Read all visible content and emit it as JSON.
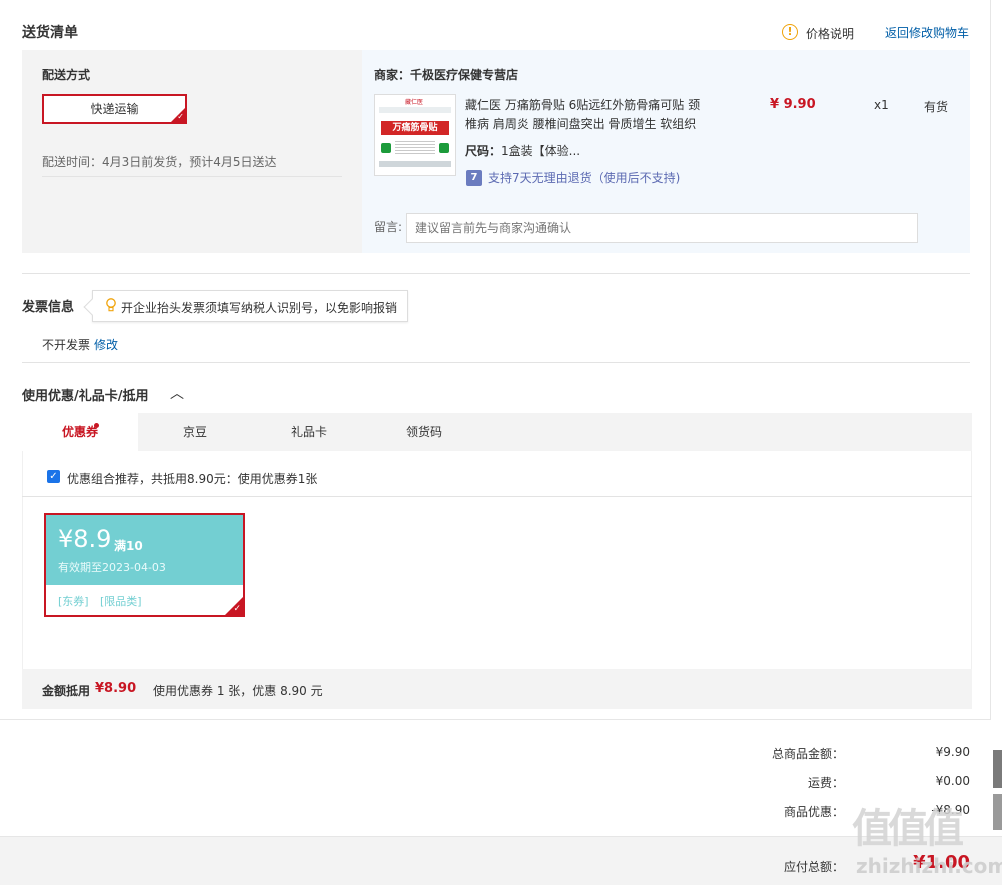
{
  "delivery": {
    "title": "送货清单",
    "price_note": "价格说明",
    "back_to_cart": "返回修改购物车",
    "method_label": "配送方式",
    "method_value": "快递运输",
    "delivery_time": "配送时间：4月3日前发货，预计4月5日送达"
  },
  "merchant": {
    "name": "商家：千极医疗保健专营店",
    "product": {
      "title_line1": "藏仁医 万痛筋骨贴 6贴远红外筋骨痛可贴 颈",
      "title_line2": "椎病 肩周炎 腰椎间盘突出 骨质增生 软组织",
      "image_text": "万痛筋骨贴",
      "image_brand": "藏仁医",
      "price": "¥ 9.90",
      "qty": "x1",
      "stock": "有货",
      "size_label": "尺码：",
      "size_value": "1盒装【体验...",
      "return_icon_text": "7",
      "return_policy": "支持7天无理由退货（使用后不支持)"
    },
    "message_label": "留言:",
    "message_placeholder": "建议留言前先与商家沟通确认"
  },
  "invoice": {
    "title": "发票信息",
    "tip": "开企业抬头发票须填写纳税人识别号，以免影响报销",
    "status": "不开发票",
    "edit": "修改"
  },
  "discount": {
    "title": "使用优惠/礼品卡/抵用",
    "chevron": "︿",
    "tabs": [
      "优惠券",
      "京豆",
      "礼品卡",
      "领货码"
    ],
    "recommend_checked": true,
    "recommend_text": "优惠组合推荐，共抵用8.90元：使用优惠券1张",
    "coupon": {
      "amount": "¥8.9",
      "condition": "满10",
      "valid": "有效期至2023-04-03",
      "tag1": "[东券]",
      "tag2": "[限品类]"
    },
    "summary_label": "金额抵用",
    "summary_amount": "¥8.90",
    "summary_detail": "使用优惠券 1 张，优惠 8.90 元"
  },
  "totals": {
    "goods_label": "总商品金额：",
    "goods_value": "¥9.90",
    "shipping_label": "运费：",
    "shipping_value": "¥0.00",
    "discount_label": "商品优惠：",
    "discount_value": "-¥8.90",
    "payable_label": "应付总额：",
    "payable_value": "¥1.00"
  },
  "watermark": {
    "logo": "值值值",
    "site": "zhizhizhi.com"
  },
  "colors": {
    "accent_red": "#c81623",
    "link_blue": "#005ea7",
    "coupon_teal": "#73cfd2"
  }
}
